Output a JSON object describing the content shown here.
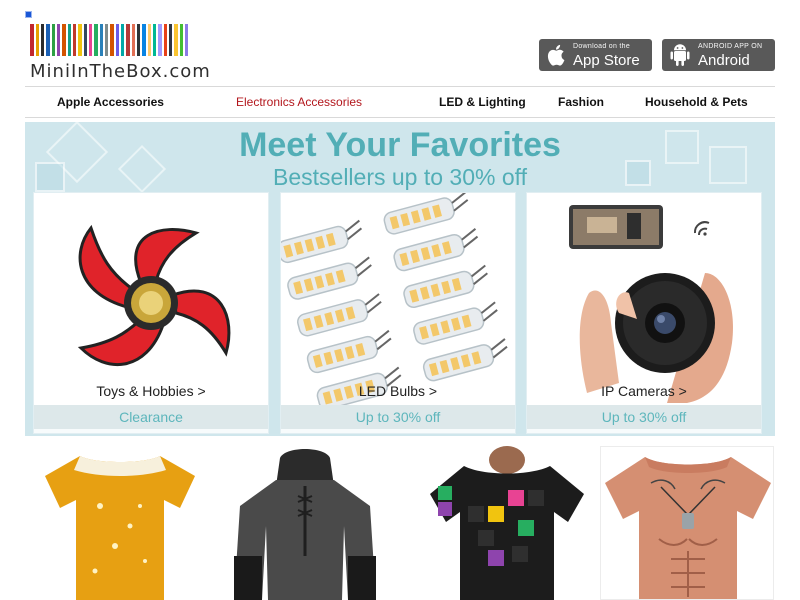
{
  "header": {
    "logo_text": "MiniInTheBox.com",
    "logo_colors": [
      "#c1272d",
      "#e6a000",
      "#2b2b2b",
      "#1a5fb4",
      "#2ea043",
      "#8e44ad",
      "#d35400",
      "#16a085",
      "#c0392b",
      "#f1c40f",
      "#34495e",
      "#e84393",
      "#27ae60",
      "#2980b9",
      "#7f8c8d",
      "#d35400",
      "#6c5ce7",
      "#00a8a8",
      "#b33939",
      "#e17055",
      "#2d3436",
      "#0984e3",
      "#fdcb6e",
      "#00b894",
      "#a29bfe",
      "#e84118",
      "#2f3640",
      "#fbc531",
      "#44bd32",
      "#8c7ae6"
    ],
    "ios_badge": {
      "small": "Download on the",
      "big": "App Store"
    },
    "android_badge": {
      "small": "ANDROID APP ON",
      "big": "Android"
    }
  },
  "nav": {
    "items": [
      {
        "label": "Apple Accessories",
        "active": false
      },
      {
        "label": "Electronics Accessories",
        "active": true
      },
      {
        "label": "LED & Lighting",
        "active": false
      },
      {
        "label": "Fashion",
        "active": false
      },
      {
        "label": "Household & Pets",
        "active": false
      }
    ]
  },
  "banner": {
    "title": "Meet Your Favorites",
    "subtitle": "Bestsellers up to 30% off",
    "cards": [
      {
        "caption": "Toys & Hobbies >",
        "footer": "Clearance"
      },
      {
        "caption": "LED Bulbs >",
        "footer": "Up to 30% off"
      },
      {
        "caption": "IP Cameras >",
        "footer": "Up to 30% off"
      }
    ]
  },
  "colors": {
    "accent_teal": "#52aeb6",
    "nav_active": "#b3171d",
    "banner_bg": "#cfe6ec"
  }
}
